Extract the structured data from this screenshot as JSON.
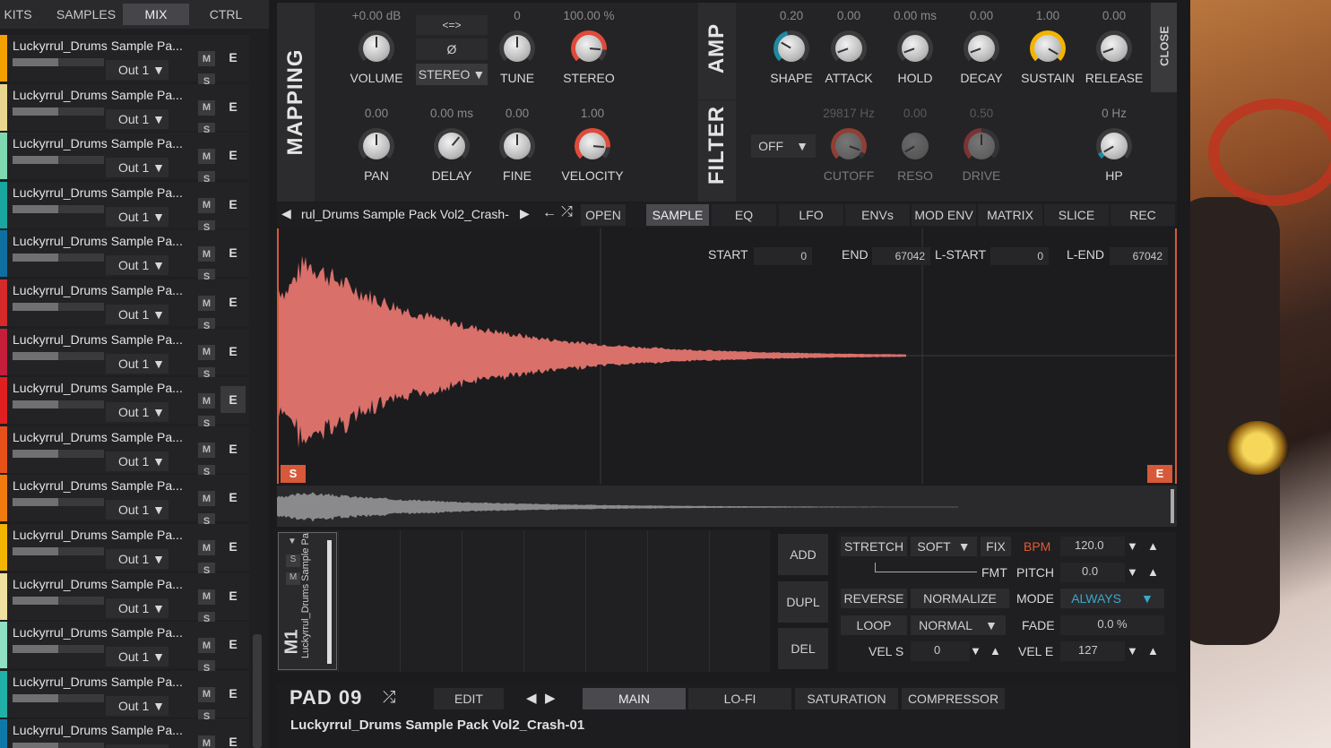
{
  "top_tabs": [
    {
      "label": "KITS"
    },
    {
      "label": "SAMPLES"
    },
    {
      "label": "MIX"
    },
    {
      "label": "CTRL"
    }
  ],
  "channels": [
    {
      "name": "Luckyrrul_Drums Sample Pa...",
      "out": "Out 1",
      "color": "#f2a100",
      "fill": 0.5
    },
    {
      "name": "Luckyrrul_Drums Sample Pa...",
      "out": "Out 1",
      "color": "#e8d690",
      "fill": 0.5
    },
    {
      "name": "Luckyrrul_Drums Sample Pa...",
      "out": "Out 1",
      "color": "#7fd8b0",
      "fill": 0.5
    },
    {
      "name": "Luckyrrul_Drums Sample Pa...",
      "out": "Out 1",
      "color": "#1aa6a0",
      "fill": 0.5
    },
    {
      "name": "Luckyrrul_Drums Sample Pa...",
      "out": "Out 1",
      "color": "#0e6fa0",
      "fill": 0.5
    },
    {
      "name": "Luckyrrul_Drums Sample Pa...",
      "out": "Out 1",
      "color": "#d42a2a",
      "fill": 0.5
    },
    {
      "name": "Luckyrrul_Drums Sample Pa...",
      "out": "Out 1",
      "color": "#c41e3a",
      "fill": 0.5
    },
    {
      "name": "Luckyrrul_Drums Sample Pa...",
      "out": "Out 1",
      "color": "#e02020",
      "fill": 0.5
    },
    {
      "name": "Luckyrrul_Drums Sample Pa...",
      "out": "Out 1",
      "color": "#e8501a",
      "fill": 0.5
    },
    {
      "name": "Luckyrrul_Drums Sample Pa...",
      "out": "Out 1",
      "color": "#f07a10",
      "fill": 0.5
    },
    {
      "name": "Luckyrrul_Drums Sample Pa...",
      "out": "Out 1",
      "color": "#f2b400",
      "fill": 0.5
    },
    {
      "name": "Luckyrrul_Drums Sample Pa...",
      "out": "Out 1",
      "color": "#f0e0a0",
      "fill": 0.5
    },
    {
      "name": "Luckyrrul_Drums Sample Pa...",
      "out": "Out 1",
      "color": "#8ee0c0",
      "fill": 0.5
    },
    {
      "name": "Luckyrrul_Drums Sample Pa...",
      "out": "Out 1",
      "color": "#20b0a8",
      "fill": 0.5
    },
    {
      "name": "Luckyrrul_Drums Sample Pa...",
      "out": "Out 1",
      "color": "#0e78aa",
      "fill": 0.5
    }
  ],
  "ms": {
    "m": "M",
    "s": "S",
    "e": "E"
  },
  "sections": {
    "mapping": "MAPPING",
    "amp": "AMP",
    "filter": "FILTER",
    "close": "CLOSE"
  },
  "mapping": {
    "volume": {
      "value": "+0.00 dB",
      "label": "VOLUME"
    },
    "tune": {
      "value": "0",
      "label": "TUNE"
    },
    "stereo": {
      "value": "100.00 %",
      "label": "STEREO"
    },
    "pan": {
      "value": "0.00",
      "label": "PAN"
    },
    "delay": {
      "value": "0.00 ms",
      "label": "DELAY"
    },
    "fine": {
      "value": "0.00",
      "label": "FINE"
    },
    "velocity": {
      "value": "1.00",
      "label": "VELOCITY"
    },
    "link_btn": "<=>",
    "phase_btn": "Ø",
    "stereo_mode": "STEREO"
  },
  "amp": {
    "shape": {
      "value": "0.20",
      "label": "SHAPE"
    },
    "attack": {
      "value": "0.00",
      "label": "ATTACK"
    },
    "hold": {
      "value": "0.00 ms",
      "label": "HOLD"
    },
    "decay": {
      "value": "0.00",
      "label": "DECAY"
    },
    "sustain": {
      "value": "1.00",
      "label": "SUSTAIN"
    },
    "release": {
      "value": "0.00",
      "label": "RELEASE"
    }
  },
  "filter": {
    "mode": "OFF",
    "cutoff": {
      "value": "29817 Hz",
      "label": "CUTOFF"
    },
    "reso": {
      "value": "0.00",
      "label": "RESO"
    },
    "drive": {
      "value": "0.50",
      "label": "DRIVE"
    },
    "hp": {
      "value": "0 Hz",
      "label": "HP"
    }
  },
  "sample_bar": {
    "filename": "rul_Drums Sample Pack Vol2_Crash-",
    "open": "OPEN",
    "tabs": [
      "SAMPLE",
      "EQ",
      "LFO",
      "ENVs",
      "MOD ENV",
      "MATRIX",
      "SLICE",
      "REC"
    ]
  },
  "markers": {
    "start_label": "START",
    "start": "0",
    "end_label": "END",
    "end": "67042",
    "lstart_label": "L-START",
    "lstart": "0",
    "lend_label": "L-END",
    "lend": "67042",
    "s_flag": "S",
    "e_flag": "E"
  },
  "pad_strip": {
    "name": "M1",
    "text": "Luckyrrul_Drums Sample Pa",
    "s": "S",
    "m": "M"
  },
  "actions": {
    "add": "ADD",
    "dupl": "DUPL",
    "del": "DEL"
  },
  "controls": {
    "stretch": "STRETCH",
    "soft": "SOFT",
    "fix": "FIX",
    "fmt": "FMT",
    "bpm_label": "BPM",
    "bpm": "120.0",
    "pitch_label": "PITCH",
    "pitch": "0.0",
    "reverse": "REVERSE",
    "normalize": "NORMALIZE",
    "mode_label": "MODE",
    "mode": "ALWAYS",
    "loop": "LOOP",
    "normal": "NORMAL",
    "fade_label": "FADE",
    "fade": "0.0 %",
    "vels_label": "VEL S",
    "vels": "0",
    "vele_label": "VEL E",
    "vele": "127"
  },
  "bottom": {
    "pad": "PAD 09",
    "edit": "EDIT",
    "tabs": [
      "MAIN",
      "LO-FI",
      "SATURATION",
      "COMPRESSOR"
    ],
    "sample_name": "Luckyrrul_Drums Sample Pack Vol2_Crash-01"
  },
  "colors": {
    "accent": "#e05a3a",
    "waveform": "#d9706a",
    "bpm": "#e05a3a",
    "mode": "#3aa8c8"
  }
}
